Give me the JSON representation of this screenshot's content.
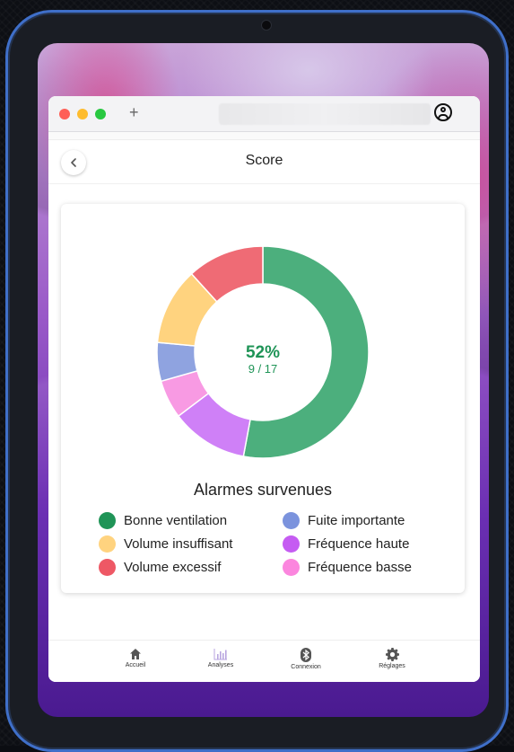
{
  "browser": {
    "new_tab_symbol": "+"
  },
  "header": {
    "title": "Score",
    "back_icon": "chevron-left-icon"
  },
  "score": {
    "percent": "52%",
    "fraction": "9 / 17"
  },
  "chart_data": {
    "type": "pie",
    "title": "Alarmes survenues",
    "categories": [
      "Bonne ventilation",
      "Fuite importante",
      "Volume insuffisant",
      "Fréquence haute",
      "Volume excessif",
      "Fréquence basse"
    ],
    "values": [
      9,
      1,
      2,
      2,
      2,
      1
    ],
    "colors": [
      "#4caf7d",
      "#8fa3e0",
      "#ffd37f",
      "#cf80f7",
      "#ef6b75",
      "#f89ae3"
    ],
    "slice_order": [
      "Bonne ventilation",
      "Fréquence haute",
      "Fréquence basse",
      "Fuite importante",
      "Volume insuffisant",
      "Volume excessif"
    ],
    "center_label": "52%",
    "center_sublabel": "9 / 17",
    "legend_position": "bottom"
  },
  "legend": {
    "title": "Alarmes survenues",
    "items": [
      {
        "label": "Bonne ventilation",
        "color": "#1f9457"
      },
      {
        "label": "Fuite importante",
        "color": "#7b93dd"
      },
      {
        "label": "Volume insuffisant",
        "color": "#ffd37f"
      },
      {
        "label": "Fréquence haute",
        "color": "#c55cf2"
      },
      {
        "label": "Volume excessif",
        "color": "#ee5865"
      },
      {
        "label": "Fréquence basse",
        "color": "#fb86de"
      }
    ]
  },
  "tabbar": {
    "items": [
      {
        "label": "Accueil",
        "icon": "home-icon"
      },
      {
        "label": "Analyses",
        "icon": "bar-chart-icon"
      },
      {
        "label": "Connexion",
        "icon": "bluetooth-icon"
      },
      {
        "label": "Réglages",
        "icon": "gear-icon"
      }
    ]
  },
  "colors": {
    "accent": "#1f9457",
    "tablet_frame": "#3f6fc9"
  }
}
